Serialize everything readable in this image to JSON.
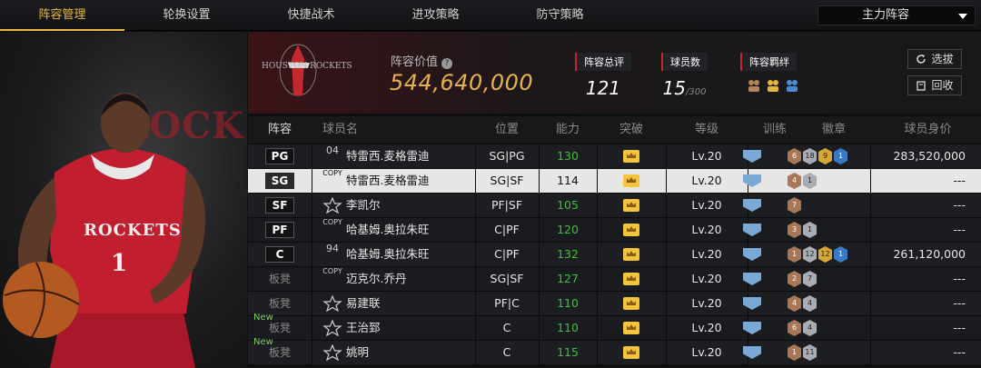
{
  "tabs": [
    {
      "label": "阵容管理",
      "active": true
    },
    {
      "label": "轮换设置",
      "active": false
    },
    {
      "label": "快捷战术",
      "active": false
    },
    {
      "label": "进攻策略",
      "active": false
    },
    {
      "label": "防守策略",
      "active": false
    }
  ],
  "lineup_select": {
    "value": "主力阵容"
  },
  "team": {
    "logo_text": "HOUSTON ROCKETS"
  },
  "player_panel": {
    "jersey_team": "ROCKETS",
    "jersey_number": "1",
    "bg_text": "ROCK"
  },
  "header": {
    "value_label": "阵容价值",
    "value": "544,640,000",
    "overall_label": "阵容总评",
    "overall_value": "121",
    "count_label": "球员数",
    "count_value": "15",
    "count_max": "/300",
    "bond_label": "阵容羁绊",
    "select_button": "选拔",
    "recycle_button": "回收"
  },
  "table": {
    "columns": [
      "阵容",
      "球员名",
      "位置",
      "能力",
      "突破",
      "等级",
      "训练",
      "徽章",
      "球员身价"
    ],
    "rows": [
      {
        "slot": "PG",
        "starter": true,
        "new": "",
        "card": "04",
        "name": "特雷西.麦格雷迪",
        "pos": "SG|PG",
        "ability": "130",
        "level": "Lv.20",
        "badges": [
          [
            "b-bronze",
            "6"
          ],
          [
            "b-silver",
            "18"
          ],
          [
            "b-gold",
            "9"
          ],
          [
            "b-blue",
            "1"
          ]
        ],
        "price": "283,520,000"
      },
      {
        "slot": "SG",
        "starter": true,
        "new": "",
        "card": "COPY",
        "name": "特雷西.麦格雷迪",
        "pos": "SG|SF",
        "ability": "114",
        "level": "Lv.20",
        "badges": [
          [
            "b-bronze",
            "4"
          ],
          [
            "b-silver",
            "1"
          ]
        ],
        "price": "---",
        "selected": true
      },
      {
        "slot": "SF",
        "starter": true,
        "new": "",
        "card": "star",
        "name": "李凯尔",
        "pos": "PF|SF",
        "ability": "105",
        "level": "Lv.20",
        "badges": [
          [
            "b-bronze",
            "7"
          ]
        ],
        "price": "---"
      },
      {
        "slot": "PF",
        "starter": true,
        "new": "",
        "card": "COPY",
        "name": "哈基姆.奥拉朱旺",
        "pos": "C|PF",
        "ability": "120",
        "level": "Lv.20",
        "badges": [
          [
            "b-bronze",
            "3"
          ],
          [
            "b-silver",
            "1"
          ]
        ],
        "price": "---"
      },
      {
        "slot": "C",
        "starter": true,
        "new": "",
        "card": "94",
        "name": "哈基姆.奥拉朱旺",
        "pos": "C|PF",
        "ability": "132",
        "level": "Lv.20",
        "badges": [
          [
            "b-bronze",
            "1"
          ],
          [
            "b-silver",
            "12"
          ],
          [
            "b-gold",
            "12"
          ],
          [
            "b-blue",
            "1"
          ]
        ],
        "price": "261,120,000"
      },
      {
        "slot": "板凳",
        "starter": false,
        "new": "",
        "card": "COPY",
        "name": "迈克尔.乔丹",
        "pos": "SG|SF",
        "ability": "127",
        "level": "Lv.20",
        "badges": [
          [
            "b-bronze",
            "2"
          ],
          [
            "b-silver",
            "7"
          ]
        ],
        "price": "---"
      },
      {
        "slot": "板凳",
        "starter": false,
        "new": "",
        "card": "star",
        "name": "易建联",
        "pos": "PF|C",
        "ability": "110",
        "level": "Lv.20",
        "badges": [
          [
            "b-bronze",
            "4"
          ],
          [
            "b-silver",
            "4"
          ]
        ],
        "price": "---"
      },
      {
        "slot": "板凳",
        "starter": false,
        "new": "New",
        "card": "star",
        "name": "王治郅",
        "pos": "C",
        "ability": "110",
        "level": "Lv.20",
        "badges": [
          [
            "b-bronze",
            "6"
          ],
          [
            "b-silver",
            "4"
          ]
        ],
        "price": "---"
      },
      {
        "slot": "板凳",
        "starter": false,
        "new": "New",
        "card": "star",
        "name": "姚明",
        "pos": "C",
        "ability": "115",
        "level": "Lv.20",
        "badges": [
          [
            "b-bronze",
            "1"
          ],
          [
            "b-silver",
            "11"
          ]
        ],
        "price": "---"
      }
    ]
  },
  "colors": {
    "accent": "#e9b93e",
    "ability_green": "#3fbf3f",
    "rockets_red": "#c2282d"
  }
}
